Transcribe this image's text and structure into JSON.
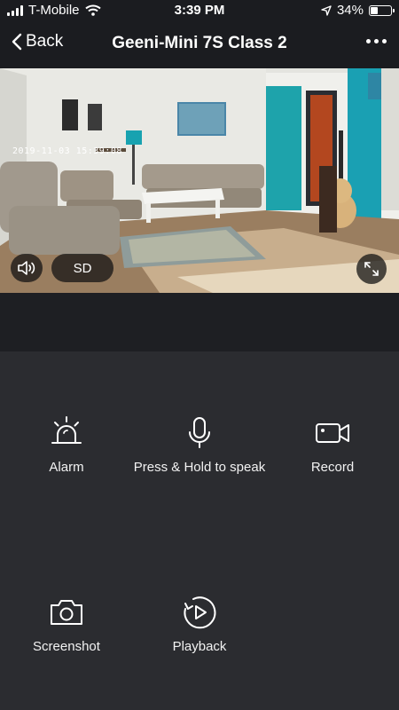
{
  "status_bar": {
    "carrier": "T-Mobile",
    "time": "3:39 PM",
    "battery_percent": "34%",
    "battery_level": 0.34,
    "icons": [
      "signal-icon",
      "wifi-icon",
      "location-arrow-icon",
      "battery-icon"
    ]
  },
  "nav": {
    "back_label": "Back",
    "title": "Geeni-Mini 7S Class 2",
    "more_icon": "more-dots-icon"
  },
  "video": {
    "timestamp": "2019-11-03 15:39:08",
    "quality_label": "SD",
    "icons": [
      "speaker-icon",
      "fullscreen-icon"
    ]
  },
  "controls": {
    "alarm": {
      "label": "Alarm",
      "icon": "alarm-siren-icon"
    },
    "speak": {
      "label": "Press & Hold to speak",
      "icon": "microphone-icon"
    },
    "record": {
      "label": "Record",
      "icon": "video-camera-icon"
    },
    "screenshot": {
      "label": "Screenshot",
      "icon": "camera-icon"
    },
    "playback": {
      "label": "Playback",
      "icon": "playback-icon"
    }
  },
  "colors": {
    "background": "#2b2c30",
    "bar": "#1b1c20",
    "text": "#ffffff"
  }
}
